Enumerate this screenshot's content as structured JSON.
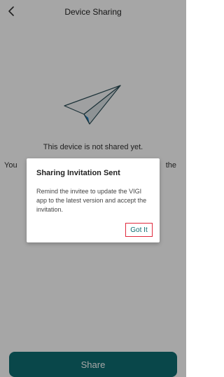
{
  "header": {
    "title": "Device Sharing",
    "back_icon": "chevron-left-icon"
  },
  "empty_state": {
    "illustration_icon": "paper-plane-icon",
    "message": "This device is not shared yet.",
    "hint_left_fragment": "You",
    "hint_right_fragment": "the"
  },
  "footer": {
    "share_label": "Share",
    "accent_color": "#0e6d72"
  },
  "dialog": {
    "title": "Sharing Invitation Sent",
    "message": "Remind the invitee to update the VIGI app to the latest version and accept the invitation.",
    "confirm_label": "Got It",
    "highlight_color": "#e0293d"
  }
}
